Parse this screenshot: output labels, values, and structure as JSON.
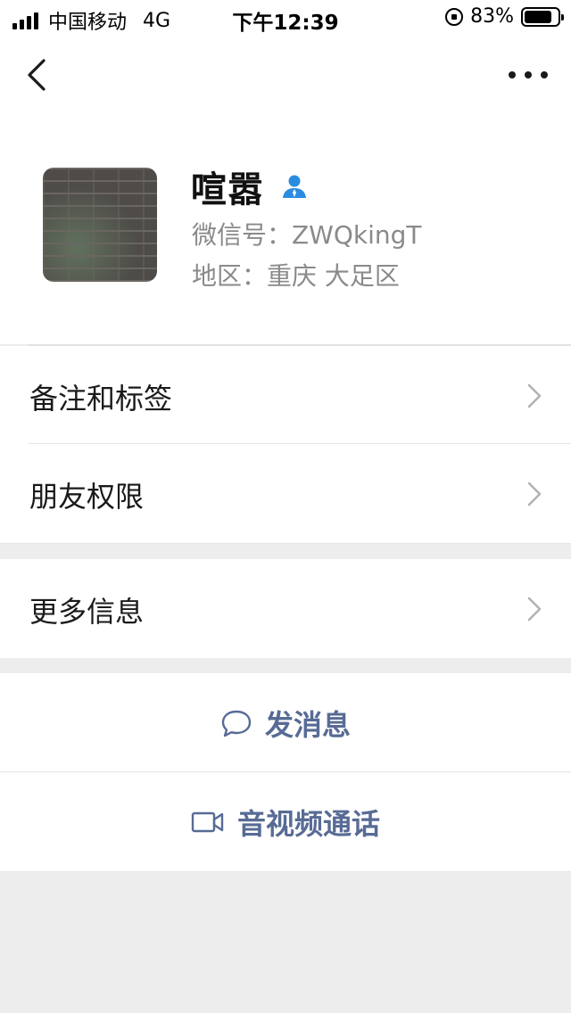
{
  "status_bar": {
    "carrier": "中国移动",
    "network": "4G",
    "time": "下午12:39",
    "battery_percent": "83%",
    "battery_level": 0.83
  },
  "nav": {
    "back_icon": "chevron-left-icon",
    "more_icon": "more-dots-icon"
  },
  "profile": {
    "nickname": "喧嚣",
    "wechat_id": "微信号：ZWQkingT",
    "region": "地区：重庆 大足区",
    "badge_icon": "star-friend-icon"
  },
  "rows": {
    "remarks_tags": "备注和标签",
    "friend_permissions": "朋友权限",
    "more_info": "更多信息"
  },
  "actions": {
    "send_message": "发消息",
    "video_call": "音视频通话"
  },
  "colors": {
    "link": "#576b95",
    "badge": "#2a8ce0",
    "background": "#ededed"
  }
}
